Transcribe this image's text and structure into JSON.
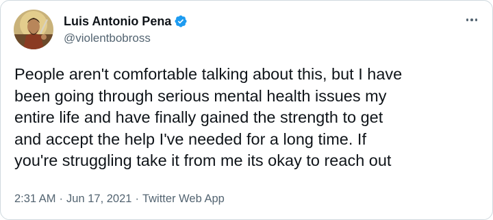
{
  "author": {
    "display_name": "Luis Antonio Pena",
    "handle": "@violentbobross",
    "verified": true,
    "avatar_icon": "painted-portrait-avatar"
  },
  "more_menu_icon": "more-options-icon",
  "tweet": {
    "text": "People aren't comfortable talking about this, but I have\nbeen going through serious mental health issues my\nentire life and have finally gained the strength to get\nand accept the help I've needed for a long time. If\nyou're struggling take it from me its okay to reach out"
  },
  "meta": {
    "time": "2:31 AM",
    "separator": "·",
    "date": "Jun 17, 2021",
    "source": "Twitter Web App"
  },
  "colors": {
    "text_primary": "#0f1419",
    "text_secondary": "#536471",
    "verified_blue": "#1d9bf0",
    "border": "#cfd9de"
  }
}
